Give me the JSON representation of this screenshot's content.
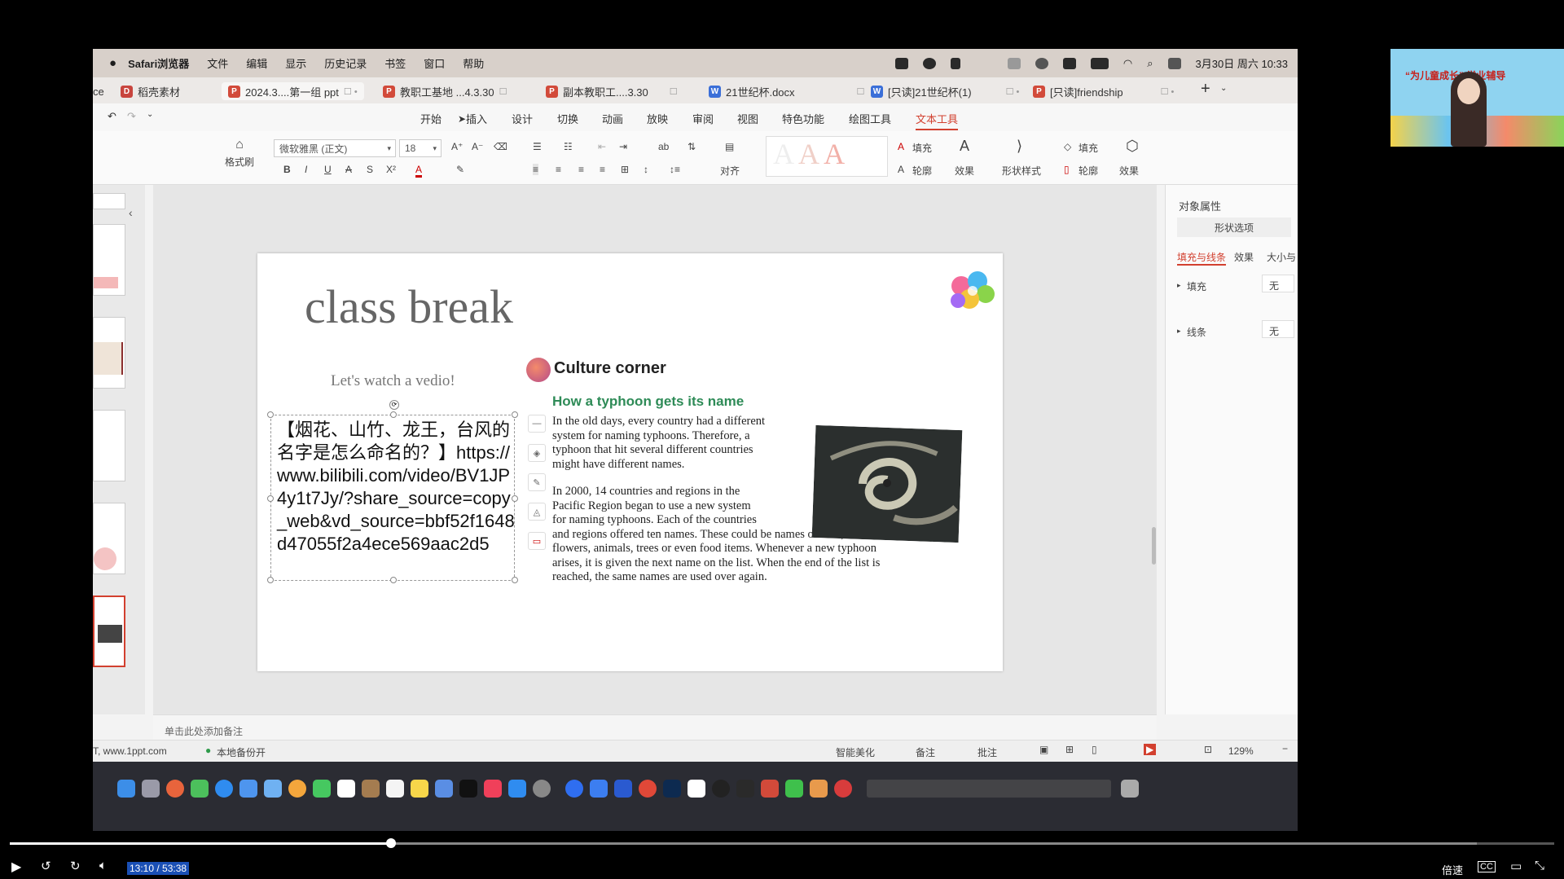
{
  "menubar": {
    "app": "Safari浏览器",
    "items": [
      "文件",
      "编辑",
      "显示",
      "历史记录",
      "书签",
      "窗口",
      "帮助"
    ],
    "datetime": "3月30日 周六 10:33"
  },
  "tabs": [
    {
      "label": "ce",
      "type": "none"
    },
    {
      "label": "稻壳素材",
      "type": "docer"
    },
    {
      "label": "2024.3....第一组 ppt",
      "type": "P"
    },
    {
      "label": "教职工基地 ...4.3.30",
      "type": "P"
    },
    {
      "label": "副本教职工....3.30",
      "type": "P"
    },
    {
      "label": "21世纪杯.docx",
      "type": "W"
    },
    {
      "label": "[只读]21世纪杯(1)",
      "type": "W"
    },
    {
      "label": "[只读]friendship",
      "type": "P"
    }
  ],
  "ribbon_tabs": [
    "开始",
    "插入",
    "设计",
    "切换",
    "动画",
    "放映",
    "审阅",
    "视图",
    "特色功能",
    "绘图工具",
    "文本工具"
  ],
  "ribbon_active": "文本工具",
  "ribbon": {
    "format_painter": "格式刷",
    "font_name": "微软雅黑 (正文)",
    "font_size": "18",
    "align_label": "对齐",
    "fill_label": "填充",
    "outline_label": "轮廓",
    "effect_label": "效果",
    "shape_style_label": "形状样式",
    "fill2_label": "填充",
    "outline2_label": "轮廓",
    "effect2_label": "效果"
  },
  "slide": {
    "title": "class break",
    "subtitle": "Let's watch a vedio!",
    "textbox": "【烟花、山竹、龙王，台风的名字是怎么命名的？】https://www.bilibili.com/video/BV1JP4y1t7Jy/?share_source=copy_web&vd_source=bbf52f1648d47055f2a4ece569aac2d5",
    "culture_title": "Culture corner",
    "typhoon_title": "How a typhoon gets its name",
    "para1": [
      "In the old days, every country had a different",
      "system for naming typhoons. Therefore, a",
      "typhoon that hit several different countries",
      "might have different names."
    ],
    "para2_short": [
      "In 2000, 14 countries and regions in the",
      "Pacific Region began to use a new system",
      "for naming typhoons. Each of the countries"
    ],
    "para2_long": [
      "and regions offered ten names. These could be names of men, women,",
      "flowers, animals, trees or even food items. Whenever a new typhoon",
      "arises, it is given the next name on the list. When the end of the list is",
      "reached, the same names are used over again."
    ]
  },
  "right_panel": {
    "title": "对象属性",
    "shape_options": "形状选项",
    "tabs": [
      "填充与线条",
      "效果",
      "大小与"
    ],
    "fill_label": "填充",
    "fill_value": "无",
    "line_label": "线条",
    "line_value": "无"
  },
  "notes_placeholder": "单击此处添加备注",
  "statusbar": {
    "source": "T, www.1ppt.com",
    "backup": "本地备份开",
    "smart": "智能美化",
    "notes": "备注",
    "comments": "批注",
    "zoom": "129%"
  },
  "video": {
    "time": "13:10 / 53:38",
    "speed": "倍速",
    "cc": "CC",
    "progress_fraction": 0.247,
    "buffer_fraction": 0.95
  },
  "webcam": {
    "banner": "“为儿童成长” 学业辅导"
  },
  "colors": {
    "accent": "#d2402f",
    "green_heading": "#2e8b57",
    "time_bg": "#1a4fb5"
  }
}
